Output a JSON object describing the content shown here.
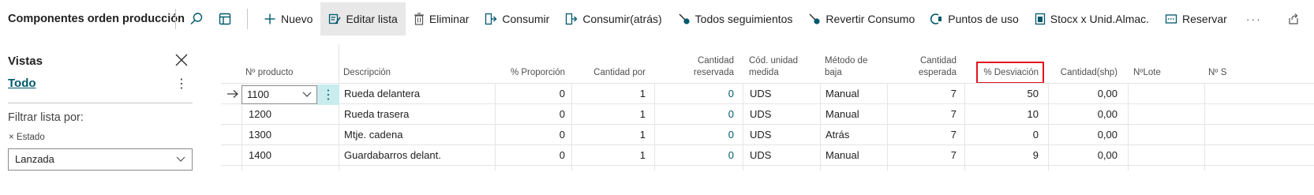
{
  "page_title": "Componentes orden producción",
  "toolbar": {
    "search_icon": "search-icon",
    "filter_pane_icon": "filter-pane-icon",
    "actions": [
      {
        "label": "Nuevo",
        "icon": "plus-icon"
      },
      {
        "label": "Editar lista",
        "icon": "edit-list-icon",
        "active": true
      },
      {
        "label": "Eliminar",
        "icon": "trash-icon"
      },
      {
        "label": "Consumir",
        "icon": "consume-icon"
      },
      {
        "label": "Consumir(atrás)",
        "icon": "consume-back-icon"
      },
      {
        "label": "Todos seguimientos",
        "icon": "tracking-icon"
      },
      {
        "label": "Revertir Consumo",
        "icon": "revert-icon"
      },
      {
        "label": "Puntos de uso",
        "icon": "usage-points-icon"
      },
      {
        "label": "Stocx x Unid.Almac.",
        "icon": "stock-icon"
      },
      {
        "label": "Reservar",
        "icon": "reserve-icon"
      }
    ],
    "more_label": "···",
    "share_icon": "share-icon"
  },
  "pane": {
    "title": "Vistas",
    "view_name": "Todo",
    "filter_label": "Filtrar lista por:",
    "filter_chip": "Estado",
    "filter_value": "Lanzada"
  },
  "grid": {
    "columns": [
      {
        "label": "Nº producto",
        "align": "left"
      },
      {
        "label": "Descripción",
        "align": "left"
      },
      {
        "label": "% Proporción",
        "align": "right"
      },
      {
        "label": "Cantidad por",
        "align": "right"
      },
      {
        "label": "Cantidad reservada",
        "align": "right"
      },
      {
        "label": "Cód. unidad medida",
        "align": "left"
      },
      {
        "label": "Método de baja",
        "align": "left"
      },
      {
        "label": "Cantidad esperada",
        "align": "right"
      },
      {
        "label": "% Desviación",
        "align": "right"
      },
      {
        "label": "Cantidad(shp)",
        "align": "right"
      },
      {
        "label": "NºLote",
        "align": "left"
      },
      {
        "label": "Nº S",
        "align": "left"
      }
    ],
    "rows": [
      {
        "producto": "1100",
        "descripcion": "Rueda delantera",
        "proporcion": "0",
        "cantidad_por": "1",
        "reservada": "0",
        "unidad": "UDS",
        "metodo": "Manual",
        "esperada": "7",
        "desviacion": "50",
        "shp": "0,00"
      },
      {
        "producto": "1200",
        "descripcion": "Rueda trasera",
        "proporcion": "0",
        "cantidad_por": "1",
        "reservada": "0",
        "unidad": "UDS",
        "metodo": "Manual",
        "esperada": "7",
        "desviacion": "10",
        "shp": "0,00"
      },
      {
        "producto": "1300",
        "descripcion": "Mtje. cadena",
        "proporcion": "0",
        "cantidad_por": "1",
        "reservada": "0",
        "unidad": "UDS",
        "metodo": "Atrás",
        "esperada": "7",
        "desviacion": "0",
        "shp": "0,00"
      },
      {
        "producto": "1400",
        "descripcion": "Guardabarros delant.",
        "proporcion": "0",
        "cantidad_por": "1",
        "reservada": "0",
        "unidad": "UDS",
        "metodo": "Manual",
        "esperada": "7",
        "desviacion": "9",
        "shp": "0,00"
      }
    ],
    "row_actions_label": "⋮",
    "highlighted_column": "% Desviación"
  },
  "colors": {
    "accent": "#00586b",
    "highlight": "#e0141e",
    "active_bg": "#e8e8e8"
  }
}
